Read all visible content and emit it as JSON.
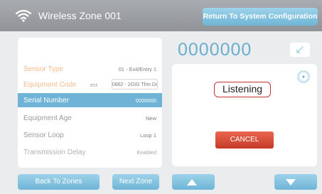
{
  "header": {
    "title": "Wireless Zone 001",
    "return_label": "Return To System Configuration"
  },
  "sensor_rows": [
    {
      "label": "Sensor Type",
      "value": "01 - Exit/Entry 1"
    },
    {
      "label": "Equipment Code",
      "prefix": "ect",
      "value": "0862 - 2GIG Thin Door"
    },
    {
      "label": "Serial Number",
      "value": "0000000"
    },
    {
      "label": "Equipment Age",
      "value": "New"
    },
    {
      "label": "Sensor Loop",
      "value": "Loop 1"
    },
    {
      "label": "Transmission Delay",
      "value": "Enabled"
    }
  ],
  "serial_display": "0000000",
  "status": {
    "listening": "Listening"
  },
  "buttons": {
    "cancel": "CANCEL",
    "back_to_zones": "Back To Zones",
    "next_zone": "Next Zone"
  },
  "colors": {
    "accent": "#6fb4d6",
    "cancel": "#d94a34",
    "listening_border": "#c43333",
    "orange_label": "#f5bb8a"
  },
  "icons": [
    "wifi-icon",
    "backspace-arrow-icon",
    "radio-indicator-icon",
    "up-arrow-icon",
    "down-arrow-icon"
  ]
}
